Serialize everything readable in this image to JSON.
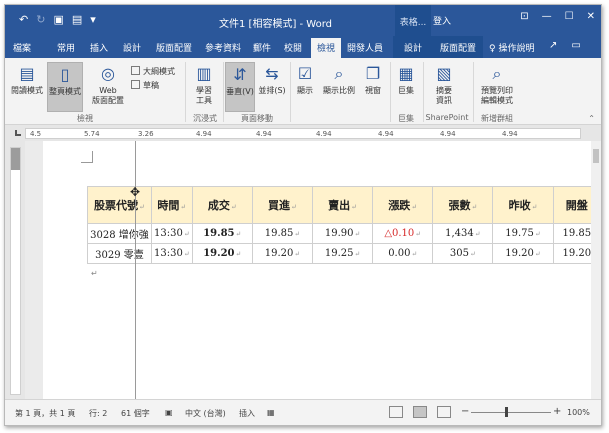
{
  "titlebar": {
    "doc_title": "文件1 [相容模式] - Word",
    "table_tools": "表格...",
    "signin": "登入",
    "qat_icons": [
      "undo-icon",
      "redo-icon",
      "save-icon",
      "save-as-icon",
      "customize-icon"
    ]
  },
  "tabs": {
    "items": [
      "檔案",
      "常用",
      "插入",
      "設計",
      "版面配置",
      "參考資料",
      "郵件",
      "校閱",
      "檢視",
      "開發人員",
      "設計",
      "版面配置"
    ],
    "active": "檢視",
    "tellme": "操作說明"
  },
  "ribbon": {
    "buttons": {
      "read_mode": "閱讀模式",
      "print_layout": "整頁模式",
      "web_layout_1": "Web",
      "web_layout_2": "版面配置",
      "outline": "大綱模式",
      "draft": "草稿",
      "learning_tools_1": "學習",
      "learning_tools_2": "工具",
      "vertical": "垂直(V)",
      "side_to_side": "並排(S)",
      "show": "顯示",
      "zoom": "顯示比例",
      "window": "視窗",
      "macros": "巨集",
      "summary_1": "摘要",
      "summary_2": "資訊",
      "preview_1": "預覽列印",
      "preview_2": "編輯模式"
    },
    "groups": {
      "views": "檢視",
      "immersive": "沉浸式",
      "page_movement": "頁面移動",
      "macros": "巨集",
      "sharepoint": "SharePoint",
      "new_group": "新增群組"
    }
  },
  "ruler": {
    "labels": [
      "4.5",
      "5.74",
      "3.26",
      "4.94",
      "4.94",
      "4.94",
      "4.94",
      "4.94",
      "4.94"
    ]
  },
  "table": {
    "headers": [
      "股票代號",
      "時間",
      "成交",
      "買進",
      "賣出",
      "漲跌",
      "張數",
      "昨收",
      "開盤"
    ],
    "rows": [
      [
        "3028 增你強",
        "13:30",
        "19.85",
        "19.85",
        "19.90",
        "△0.10",
        "1,434",
        "19.75",
        "19.85"
      ],
      [
        "3029 零壹",
        "13:30",
        "19.20",
        "19.20",
        "19.25",
        "0.00",
        "305",
        "19.20",
        "19.20"
      ]
    ],
    "colors": {
      "header_bg": "#fff2cc",
      "up_color": "#d62828"
    }
  },
  "status": {
    "page": "第 1 頁，共 1 頁",
    "line": "行: 2",
    "words": "61 個字",
    "language": "中文 (台灣)",
    "mode": "插入",
    "zoom": "100%"
  }
}
